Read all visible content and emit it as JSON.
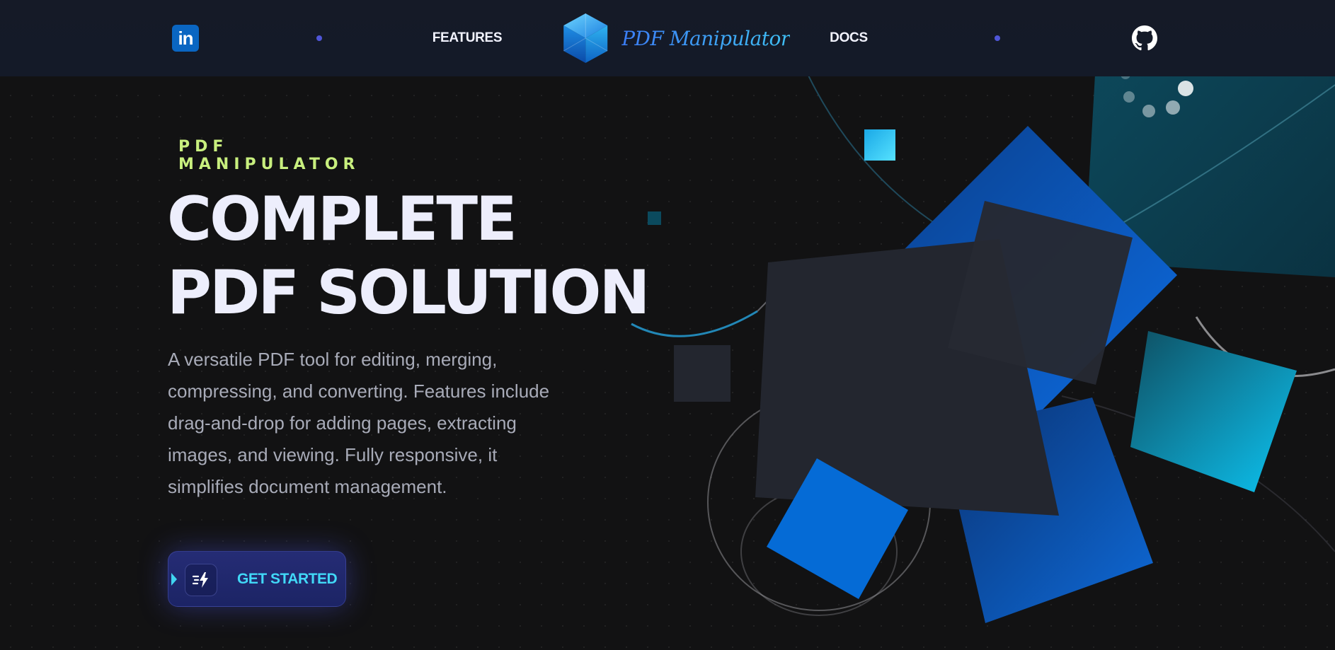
{
  "nav": {
    "linkedin_icon": "linkedin-icon",
    "features_label": "FEATURES",
    "brand_name": "PDF Manipulator",
    "docs_label": "DOCS",
    "github_icon": "github-icon",
    "linkedin_glyph": "in"
  },
  "hero": {
    "eyebrow": "PDF MANIPULATOR",
    "headline_line1": "COMPLETE",
    "headline_line2": "PDF SOLUTION",
    "description": "A versatile PDF tool for editing, merging, compressing, and converting. Features include drag-and-drop for adding pages, extracting images, and viewing. Fully responsive, it simplifies document management.",
    "cta_label": "GET STARTED",
    "cta_icon": "fast-bolt-icon"
  },
  "colors": {
    "background": "#121213",
    "nav_background": "#151a27",
    "accent_green": "#c8ef7e",
    "accent_cyan": "#41d8f7",
    "brand_blue": "#0a66c2",
    "nav_dot": "#4f56d8"
  }
}
